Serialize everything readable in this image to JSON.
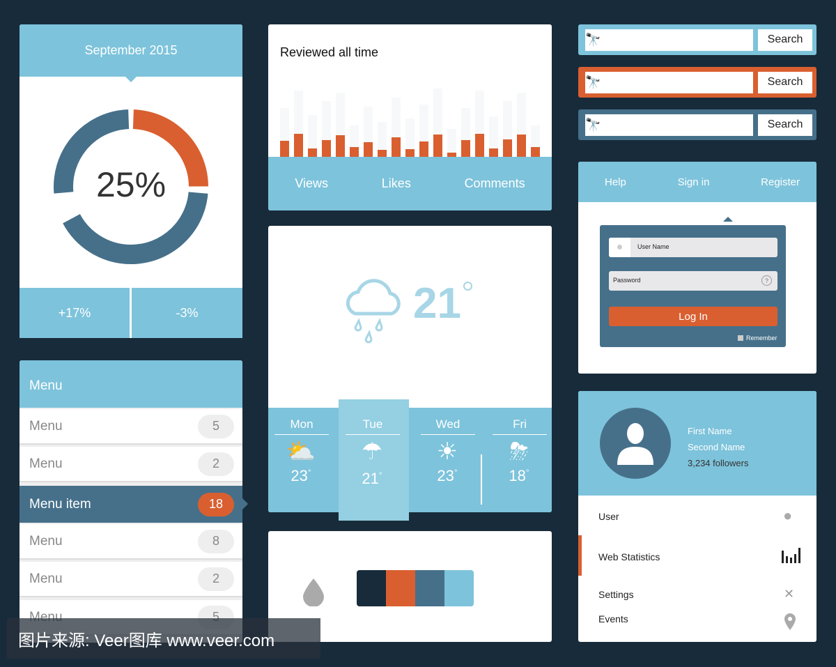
{
  "colors": {
    "background": "#182b3a",
    "light_blue": "#7dc3db",
    "orange": "#d95f30",
    "dark_blue": "#46708a"
  },
  "stats_card": {
    "title": "September 2015",
    "percent": "25%",
    "percent_value": 25,
    "left": "+17%",
    "right": "-3%"
  },
  "menu": {
    "title": "Menu",
    "items": [
      {
        "label": "Menu",
        "count": "5",
        "active": false
      },
      {
        "label": "Menu",
        "count": "2",
        "active": false
      },
      {
        "label": "Menu item",
        "count": "18",
        "active": true
      },
      {
        "label": "Menu",
        "count": "8",
        "active": false
      },
      {
        "label": "Menu",
        "count": "2",
        "active": false
      },
      {
        "label": "Menu",
        "count": "5",
        "active": false
      }
    ]
  },
  "review": {
    "title": "Reviewed all time",
    "tabs": [
      "Views",
      "Likes",
      "Comments"
    ],
    "bars": [
      23,
      33,
      12,
      24,
      31,
      14,
      21,
      10,
      28,
      11,
      22,
      32,
      6,
      24,
      33,
      12,
      25,
      32,
      14
    ],
    "bg_bars": [
      70,
      95,
      60,
      80,
      92,
      45,
      72,
      50,
      85,
      55,
      75,
      98,
      40,
      70,
      95,
      58,
      80,
      92,
      45
    ]
  },
  "weather": {
    "icon": "cloud-rain-icon",
    "temp": "21",
    "days": [
      {
        "name": "Mon",
        "temp": "23",
        "icon": "partly-cloudy-icon"
      },
      {
        "name": "Tue",
        "temp": "21",
        "icon": "cloud-rain-icon"
      },
      {
        "name": "Wed",
        "temp": "23",
        "icon": "sun-icon"
      },
      {
        "name": "Fri",
        "temp": "18",
        "icon": "storm-icon"
      }
    ]
  },
  "palette": {
    "swatches": [
      "#182b3a",
      "#d95f30",
      "#46708a",
      "#7dc3db"
    ]
  },
  "search": [
    {
      "button": "Search",
      "color": "#7dc3db"
    },
    {
      "button": "Search",
      "color": "#d95f30"
    },
    {
      "button": "Search",
      "color": "#46708a"
    }
  ],
  "login": {
    "nav": [
      "Help",
      "Sign in",
      "Register"
    ],
    "username_placeholder": "User Name",
    "password_placeholder": "Password",
    "button": "Log In",
    "remember": "Remember"
  },
  "profile": {
    "first": "First Name",
    "second": "Second Name",
    "followers": "3,234 followers",
    "items": [
      {
        "label": "User",
        "icon": "user-icon"
      },
      {
        "label": "Web Statistics",
        "icon": "bar-chart-icon"
      },
      {
        "label": "Settings",
        "icon": "tools-icon"
      },
      {
        "label": "Events",
        "icon": "location-pin-icon"
      }
    ]
  },
  "watermark": "图片来源: Veer图库 www.veer.com"
}
